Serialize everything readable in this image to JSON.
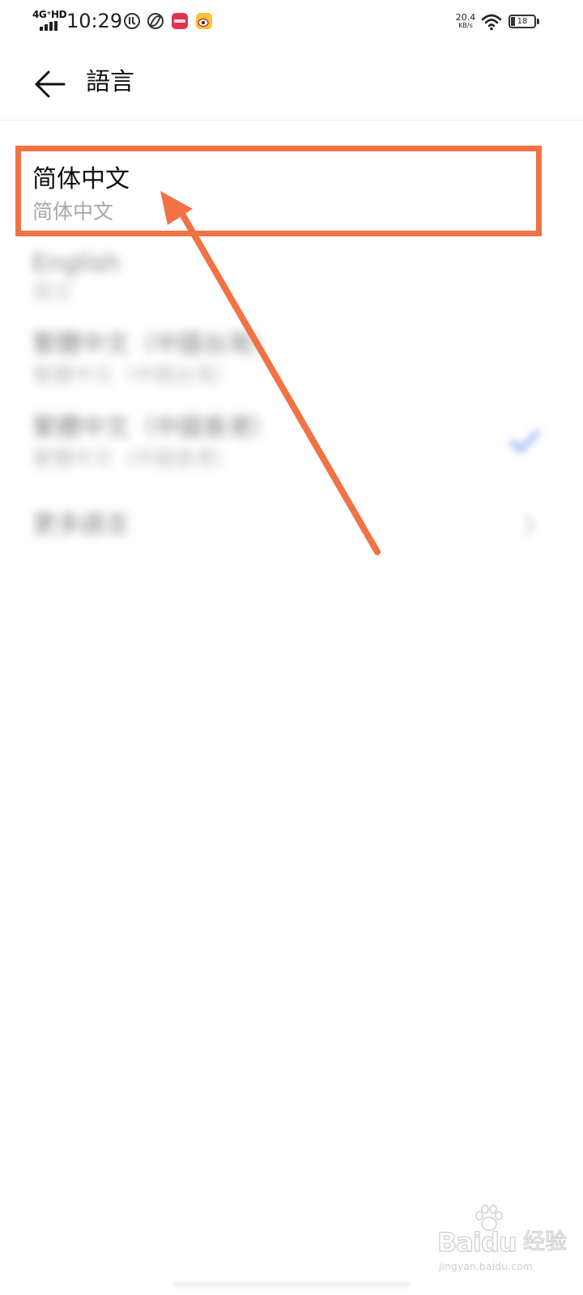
{
  "status_bar": {
    "network_type": "4G⁺HD",
    "time": "10:29",
    "net_speed_value": "20.4",
    "net_speed_unit": "KB/s",
    "battery_level": "18",
    "icons": [
      "signal-icon",
      "app-notification-icon",
      "sync-icon",
      "red-app-icon",
      "weibo-icon",
      "wifi-icon",
      "battery-icon"
    ]
  },
  "header": {
    "title": "語言",
    "back_icon": "arrow-left-icon"
  },
  "languages": [
    {
      "label": "简体中文",
      "sublabel": "简体中文"
    },
    {
      "label": "English",
      "sublabel": "英文"
    },
    {
      "label": "繁體中文（中國台灣）",
      "sublabel": "繁體中文（中國台灣）"
    },
    {
      "label": "繁體中文（中國香港）",
      "sublabel": "繁體中文（中國香港）"
    },
    {
      "label": "更多語言",
      "sublabel": ""
    }
  ],
  "selected_index": 3,
  "colors": {
    "annotation": "#f07245",
    "selected_check": "#4a7bf0",
    "background": "#ffffff"
  },
  "watermark": {
    "logo": "Baidu",
    "sub": "经验",
    "url": "jingyan.baidu.com"
  }
}
